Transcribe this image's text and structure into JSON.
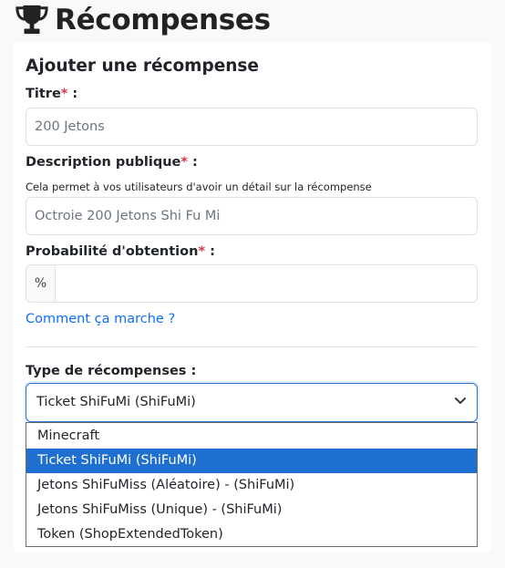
{
  "header": {
    "title": "Récompenses",
    "icon": "trophy-icon"
  },
  "form": {
    "card_title": "Ajouter une récompense",
    "title_field": {
      "label": "Titre",
      "required_mark": "*",
      "label_suffix": " :",
      "placeholder": "200 Jetons",
      "value": ""
    },
    "description_field": {
      "label": "Description publique",
      "required_mark": "*",
      "label_suffix": " :",
      "help": "Cela permet à vos utilisateurs d'avoir un détail sur la récompense",
      "placeholder": "Octroie 200 Jetons Shi Fu Mi",
      "value": ""
    },
    "probability_field": {
      "label": "Probabilité d'obtention",
      "required_mark": "*",
      "label_suffix": " :",
      "addon": "%",
      "value": ""
    },
    "help_link": "Comment ça marche ?",
    "reward_type": {
      "label": "Type de récompenses :",
      "selected": "Ticket ShiFuMi (ShiFuMi)",
      "options": [
        "Minecraft",
        "Ticket ShiFuMi (ShiFuMi)",
        "Jetons ShiFuMiss (Aléatoire) - (ShiFuMi)",
        "Jetons ShiFuMiss (Unique) - (ShiFuMi)",
        "Token (ShopExtendedToken)"
      ],
      "selected_index": 1
    }
  },
  "colors": {
    "accent": "#0d6efd",
    "required": "#dc3545",
    "option_highlight": "#1f6fd1"
  }
}
